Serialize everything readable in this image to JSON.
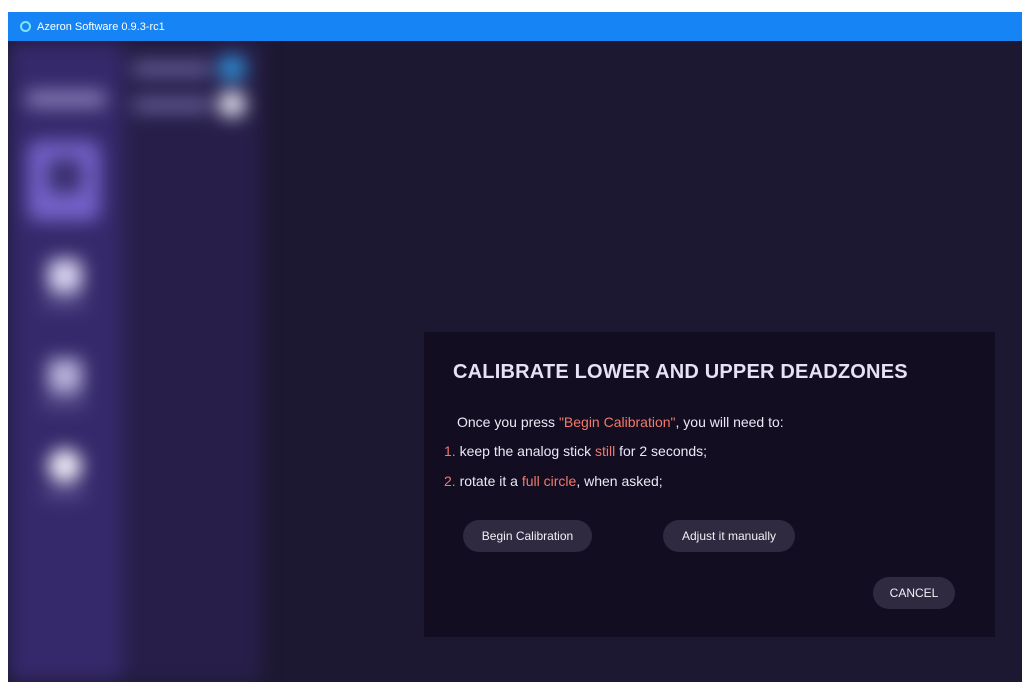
{
  "window": {
    "title": "Azeron Software 0.9.3-rc1",
    "icon": "azeron-logo-icon"
  },
  "colors": {
    "titlebar": "#1684f5",
    "background": "#1d1831",
    "dialog": "#120d21",
    "highlight": "#f27a6a",
    "button": "#2f2a3f"
  },
  "dialog": {
    "title": "CALIBRATE LOWER AND UPPER DEADZONES",
    "intro_prefix": "Once you press ",
    "intro_highlight": "\"Begin Calibration\"",
    "intro_suffix": ", you will need to:",
    "step1_number": "1.",
    "step1_prefix": " keep the analog stick ",
    "step1_highlight": "still",
    "step1_suffix": " for 2 seconds;",
    "step2_number": "2.",
    "step2_prefix": " rotate it a ",
    "step2_highlight": "full circle",
    "step2_suffix": ", when asked;",
    "begin_button": "Begin Calibration",
    "adjust_button": "Adjust it manually",
    "cancel_button": "CANCEL"
  }
}
